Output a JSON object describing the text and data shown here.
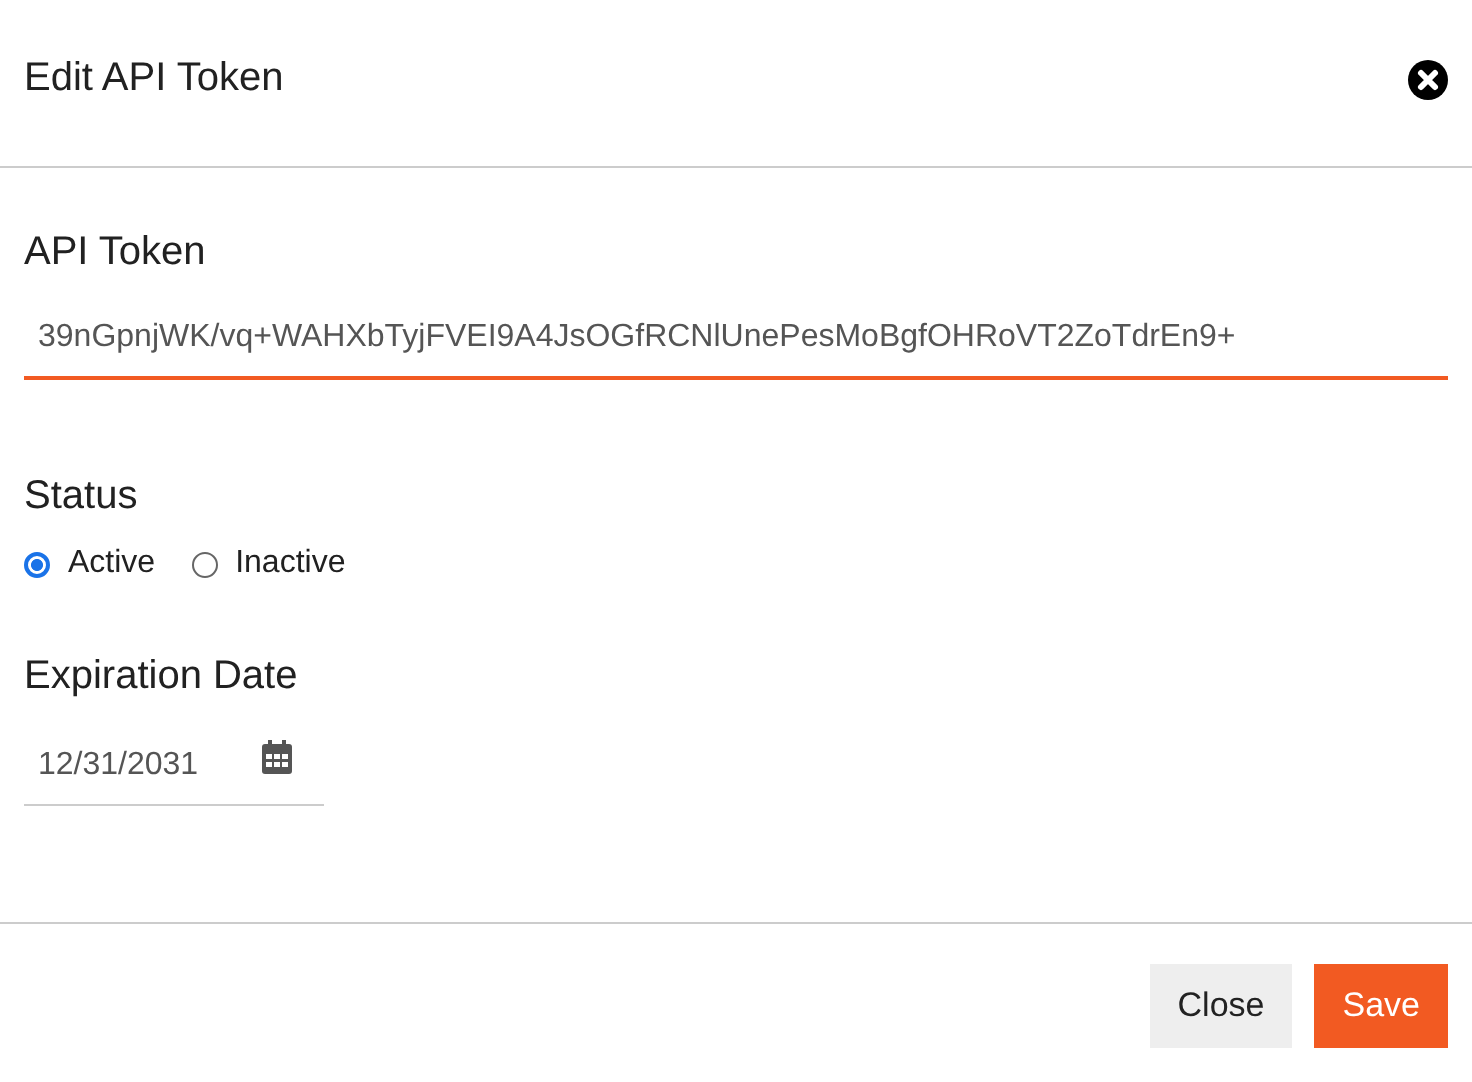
{
  "dialog": {
    "title": "Edit API Token"
  },
  "token": {
    "label": "API Token",
    "value": "39nGpnjWK/vq+WAHXbTyjFVEI9A4JsOGfRCNlUnePesMoBgfOHRoVT2ZoTdrEn9+",
    "focused": true
  },
  "status": {
    "label": "Status",
    "options": [
      {
        "label": "Active",
        "selected": true
      },
      {
        "label": "Inactive",
        "selected": false
      }
    ]
  },
  "expiration": {
    "label": "Expiration Date",
    "value": "12/31/2031"
  },
  "buttons": [
    {
      "label": "Close",
      "kind": "secondary"
    },
    {
      "label": "Save",
      "kind": "primary"
    }
  ]
}
